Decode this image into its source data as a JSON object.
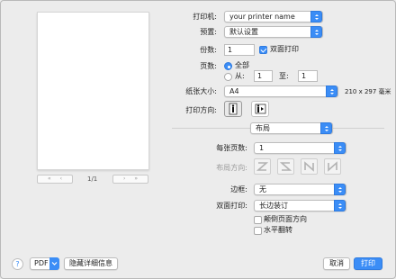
{
  "preview": {
    "page_indicator": "1/1",
    "prev_first": "«",
    "prev": "‹",
    "next": "›",
    "next_last": "»"
  },
  "printer": {
    "label": "打印机:",
    "value": "your printer name"
  },
  "presets": {
    "label": "预置:",
    "value": "默认设置"
  },
  "copies": {
    "label": "份数:",
    "value": "1",
    "duplex_label": "双面打印",
    "duplex_checked": true
  },
  "pages": {
    "label": "页数:",
    "all_label": "全部",
    "from_label": "从:",
    "from_value": "1",
    "to_label": "至:",
    "to_value": "1",
    "selected": "all"
  },
  "paper_size": {
    "label": "纸张大小:",
    "value": "A4",
    "dimensions": "210 x 297 毫米"
  },
  "orientation": {
    "label": "打印方向:",
    "options": [
      "portrait",
      "landscape"
    ],
    "selected": "portrait"
  },
  "section": {
    "value": "布局"
  },
  "layout": {
    "pages_per_sheet_label": "每张页数:",
    "pages_per_sheet_value": "1",
    "layout_direction_label": "布局方向:",
    "border_label": "边框:",
    "border_value": "无",
    "two_sided_label": "双面打印:",
    "two_sided_value": "长边装订",
    "reverse_orientation_label": "颠倒页面方向",
    "flip_horizontally_label": "水平翻转"
  },
  "footer": {
    "help": "?",
    "pdf_label": "PDF",
    "hide_details_label": "隐藏详细信息",
    "cancel_label": "取消",
    "print_label": "打印"
  },
  "colors": {
    "accent": "#3b8df6",
    "window": "#ececec"
  }
}
